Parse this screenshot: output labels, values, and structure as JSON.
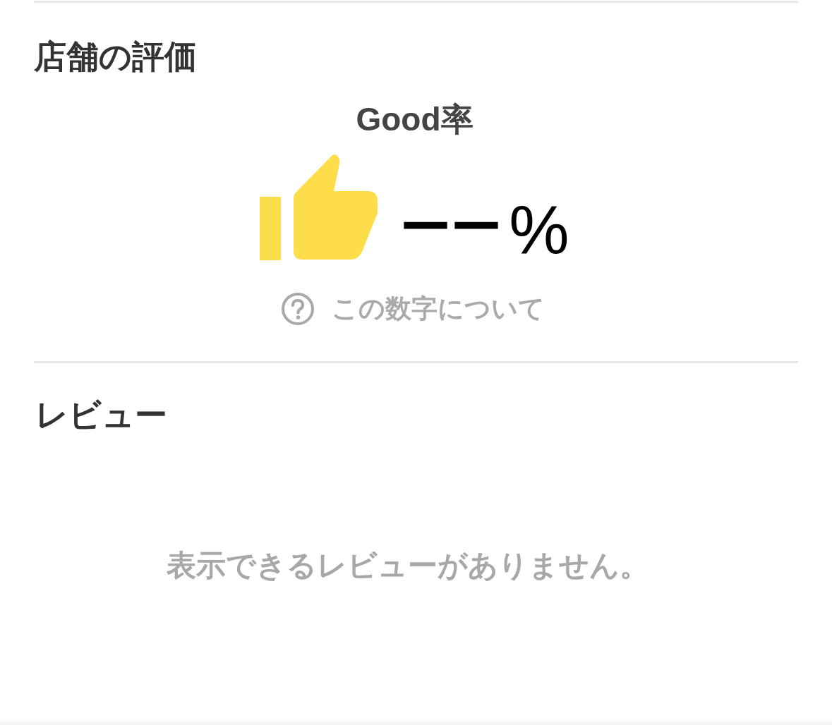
{
  "rating_section": {
    "title": "店舗の評価",
    "metric_label": "Good率",
    "value": "ーー",
    "unit": "%",
    "help_link": "この数字について"
  },
  "review_section": {
    "title": "レビュー",
    "empty_message": "表示できるレビューがありません。"
  }
}
